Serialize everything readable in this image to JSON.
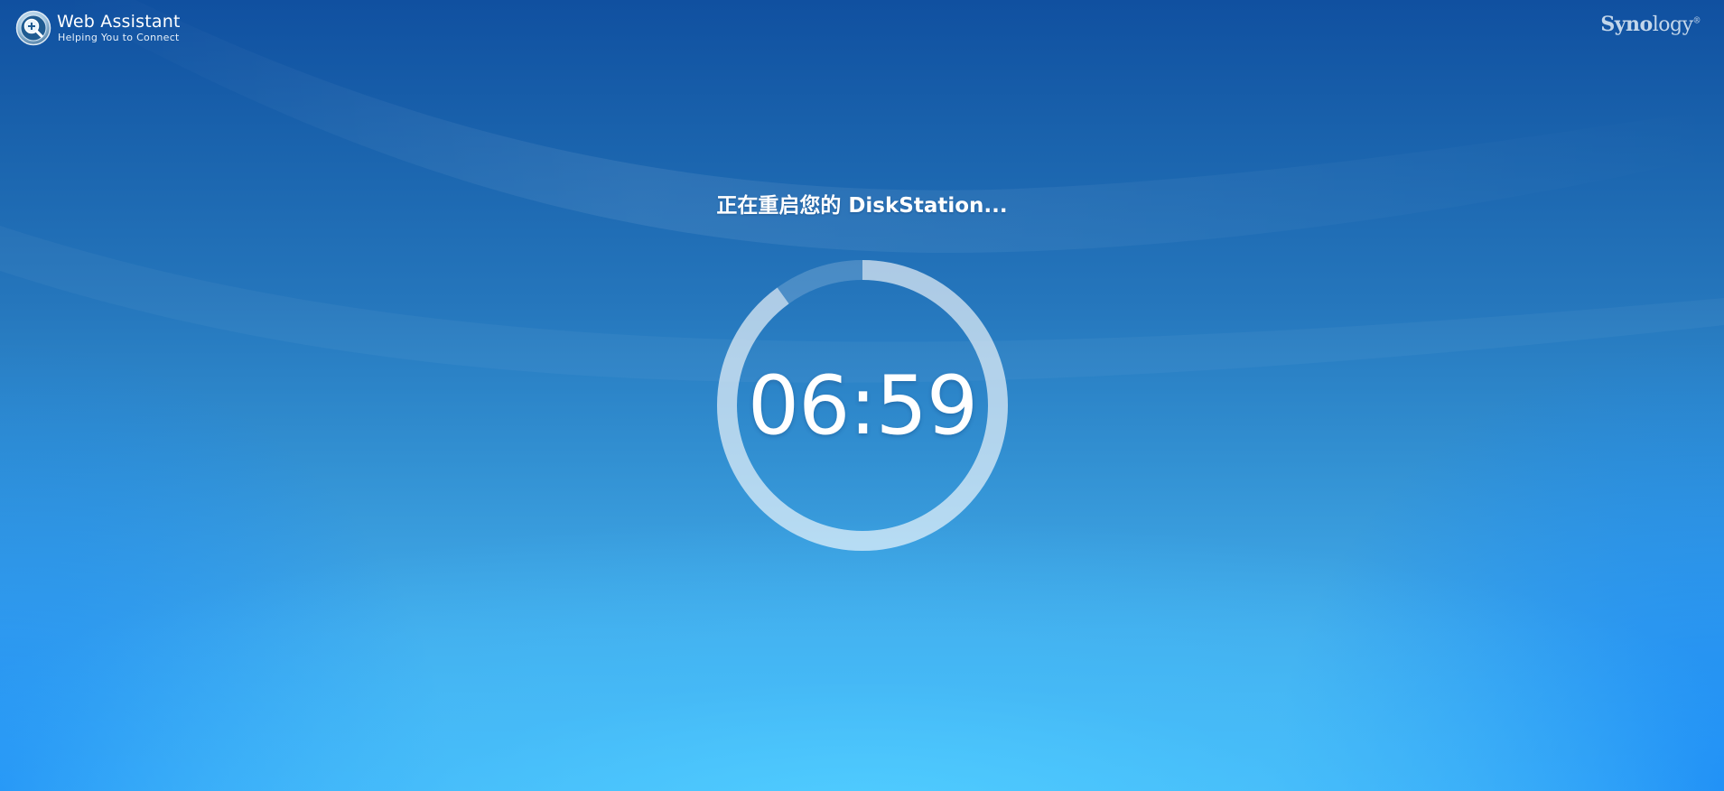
{
  "header": {
    "app_title": "Web Assistant",
    "app_subtitle": "Helping You to Connect",
    "app_icon": "magnifier-plus-icon",
    "vendor_logo_part1": "Syno",
    "vendor_logo_part2": "logy",
    "vendor_logo_mark": "®"
  },
  "status": {
    "message": "正在重启您的 DiskStation..."
  },
  "countdown": {
    "time": "06:59",
    "progress_remaining": 0.9
  },
  "colors": {
    "ring_track": "#ffffff",
    "ring_progress": "#ffffff",
    "text": "#ffffff"
  }
}
